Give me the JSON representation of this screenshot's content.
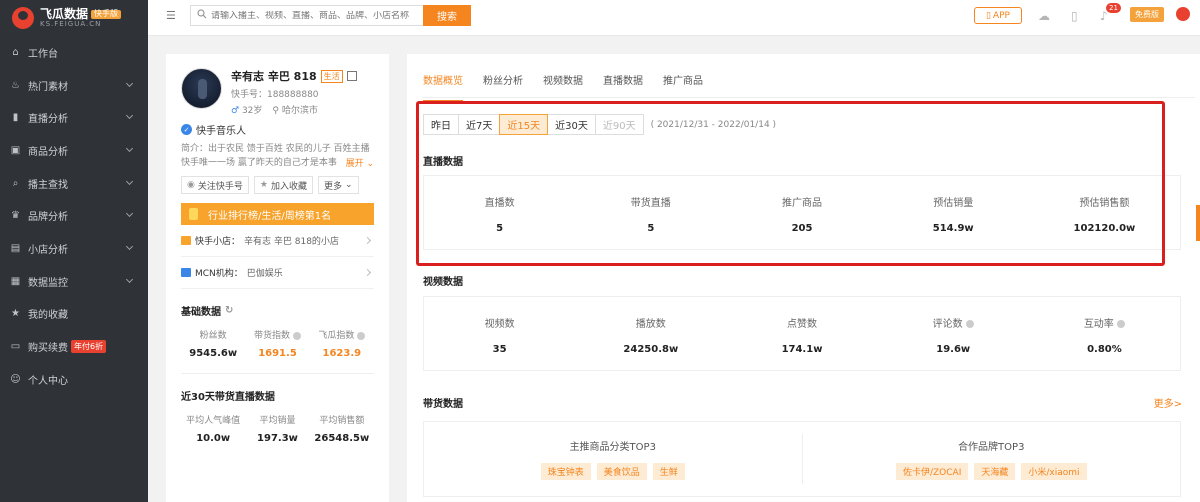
{
  "logo": {
    "title": "飞瓜数据",
    "badge": "快手版",
    "url": "KS.FEIGUA.CN"
  },
  "sidebar": {
    "items": [
      {
        "label": "工作台",
        "icon": "home-icon",
        "chevron": false
      },
      {
        "label": "热门素材",
        "icon": "fire-icon",
        "chevron": true
      },
      {
        "label": "直播分析",
        "icon": "bar-chart-icon",
        "chevron": true
      },
      {
        "label": "商品分析",
        "icon": "bag-icon",
        "chevron": true
      },
      {
        "label": "播主查找",
        "icon": "search-icon",
        "chevron": true
      },
      {
        "label": "品牌分析",
        "icon": "brand-icon",
        "chevron": true
      },
      {
        "label": "小店分析",
        "icon": "shop-icon",
        "chevron": true
      },
      {
        "label": "数据监控",
        "icon": "monitor-icon",
        "chevron": true
      },
      {
        "label": "我的收藏",
        "icon": "star-icon",
        "chevron": false
      },
      {
        "label": "购买续费",
        "icon": "card-icon",
        "chevron": false,
        "badge": "年付6折"
      },
      {
        "label": "个人中心",
        "icon": "user-icon",
        "chevron": false
      }
    ]
  },
  "topbar": {
    "search_placeholder": "请输入播主、视频、直播、商品、品牌、小店名称",
    "search_button": "搜索",
    "app_button": "APP",
    "notification_count": "21",
    "free_badge": "免费版"
  },
  "profile": {
    "name": "辛有志 辛巴 818",
    "tag": "生活",
    "kuaishou_id": "快手号：188888880",
    "age": "32岁",
    "location": "哈尔滨市",
    "verification": "快手音乐人",
    "bio": "简介：出于农民 馈于百姓 农民的儿子 百姓主播 快手唯一一场 赢了昨天的自己才是本事",
    "bio_more": "展开",
    "follow_button": "关注快手号",
    "favorite_button": "加入收藏",
    "more_button": "更多",
    "rank_banner": "行业排行榜/生活/周榜第1名",
    "shop_label": "快手小店：",
    "shop_name": "辛有志 辛巴 818的小店",
    "mcn_label": "MCN机构：",
    "mcn_name": "巴伽娱乐",
    "basic_title": "基础数据",
    "basic_stats": [
      {
        "label": "粉丝数",
        "value": "9545.6w"
      },
      {
        "label": "带货指数",
        "value": "1691.5"
      },
      {
        "label": "飞瓜指数",
        "value": "1623.9"
      }
    ],
    "live_title": "近30天带货直播数据",
    "live_stats": [
      {
        "label": "平均人气峰值",
        "value": "10.0w"
      },
      {
        "label": "平均销量",
        "value": "197.3w"
      },
      {
        "label": "平均销售额",
        "value": "26548.5w"
      }
    ]
  },
  "main": {
    "tabs": [
      "数据概览",
      "粉丝分析",
      "视频数据",
      "直播数据",
      "推广商品"
    ],
    "periods": [
      "昨日",
      "近7天",
      "近15天",
      "近30天",
      "近90天"
    ],
    "date_range": "( 2021/12/31 - 2022/01/14 )",
    "live_title": "直播数据",
    "live_stats": [
      {
        "label": "直播数",
        "value": "5"
      },
      {
        "label": "带货直播",
        "value": "5"
      },
      {
        "label": "推广商品",
        "value": "205"
      },
      {
        "label": "预估销量",
        "value": "514.9w"
      },
      {
        "label": "预估销售额",
        "value": "102120.0w"
      }
    ],
    "video_title": "视频数据",
    "video_stats": [
      {
        "label": "视频数",
        "value": "35"
      },
      {
        "label": "播放数",
        "value": "24250.8w"
      },
      {
        "label": "点赞数",
        "value": "174.1w"
      },
      {
        "label": "评论数",
        "value": "19.6w"
      },
      {
        "label": "互动率",
        "value": "0.80%"
      }
    ],
    "goods_title": "带货数据",
    "more_link": "更多>",
    "category_title": "主推商品分类TOP3",
    "categories": [
      "珠宝钟表",
      "美食饮品",
      "生鲜"
    ],
    "brand_title": "合作品牌TOP3",
    "brands": [
      "佐卡伊/ZOCAI",
      "天海藏",
      "小米/xiaomi"
    ]
  }
}
